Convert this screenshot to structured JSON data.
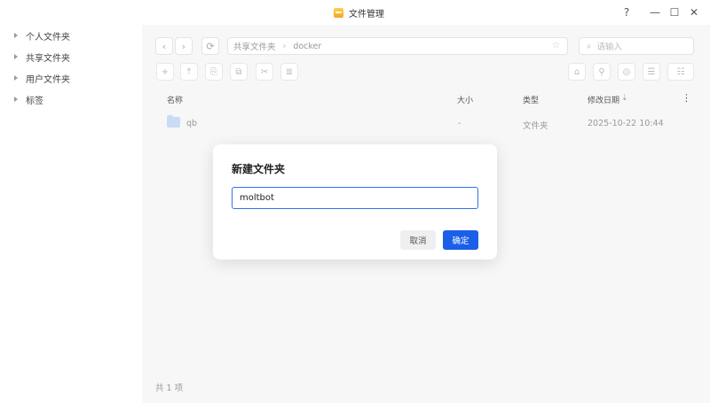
{
  "window": {
    "title": "文件管理",
    "help": "?",
    "minimize": "—",
    "maximize": "☐",
    "close": "✕"
  },
  "sidebar": {
    "items": [
      {
        "label": "个人文件夹"
      },
      {
        "label": "共享文件夹"
      },
      {
        "label": "用户文件夹"
      },
      {
        "label": "标签"
      }
    ]
  },
  "toolbar": {
    "back": "‹",
    "forward": "›",
    "refresh": "⟳",
    "path": [
      "共享文件夹",
      "docker"
    ],
    "path_sep": "›",
    "star": "☆",
    "search_placeholder": "请输入",
    "search_icon": "⌕"
  },
  "actions": {
    "new": "+",
    "upload": "⤒",
    "copy": "⎘",
    "paste": "⧉",
    "cut": "✂",
    "rename": "≣",
    "right": [
      "⌂",
      "⚲",
      "◎",
      "☰",
      "☷"
    ]
  },
  "table": {
    "headers": {
      "name": "名称",
      "size": "大小",
      "type": "类型",
      "modified": "修改日期",
      "sort": "⇣",
      "more": "⋮"
    },
    "rows": [
      {
        "name": "qb",
        "size": "-",
        "type": "文件夹",
        "modified": "2025-10-22 10:44"
      }
    ]
  },
  "footer": {
    "count": "共 1 项"
  },
  "dialog": {
    "title": "新建文件夹",
    "value": "moltbot",
    "cancel": "取消",
    "ok": "确定"
  }
}
